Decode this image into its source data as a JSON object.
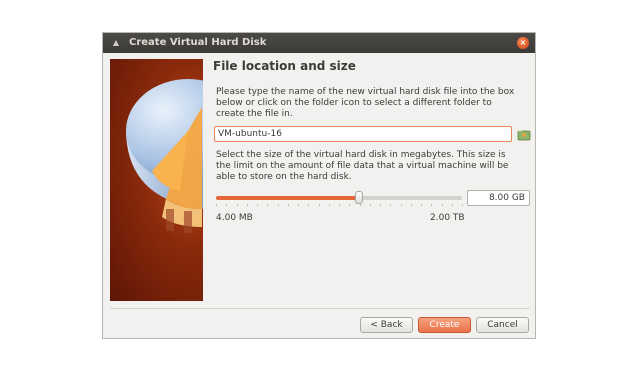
{
  "window": {
    "title": "Create Virtual Hard Disk"
  },
  "heading": "File location and size",
  "location": {
    "description": "Please type the name of the new virtual hard disk file into the box below or click on the folder icon to select a different folder to create the file in.",
    "value": "VM-ubuntu-16",
    "folder_icon": "folder-icon"
  },
  "size": {
    "description": "Select the size of the virtual hard disk in megabytes. This size is the limit on the amount of file data that a virtual machine will be able to store on the hard disk.",
    "value": "8.00 GB",
    "slider_fraction": 0.58,
    "min_label": "4.00 MB",
    "max_label": "2.00 TB"
  },
  "buttons": {
    "back": "< Back",
    "create": "Create",
    "cancel": "Cancel"
  },
  "colors": {
    "accent": "#e4683a",
    "titlebar": "#3c3b37"
  }
}
